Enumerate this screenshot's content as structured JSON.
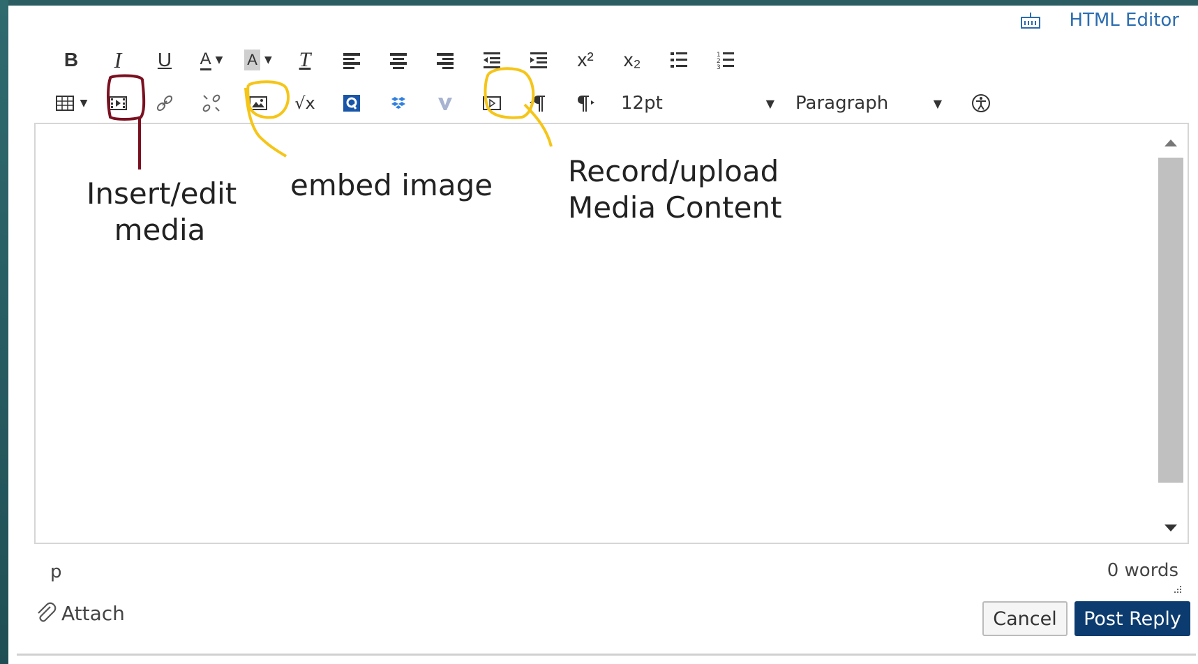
{
  "header": {
    "html_editor_label": "HTML Editor"
  },
  "toolbar": {
    "bold": "B",
    "italic": "I",
    "underline": "U",
    "text_color": "A",
    "bg_color": "A",
    "clear_format": "T",
    "superscript": "x²",
    "subscript": "x₂",
    "font_size": "12pt",
    "paragraph": "Paragraph",
    "math_label": "√x"
  },
  "annotations": {
    "insert_edit_media_line1": "Insert/edit",
    "insert_edit_media_line2": "media",
    "embed_image": "embed image",
    "record_upload_line1": "Record/upload",
    "record_upload_line2": "Media Content"
  },
  "status": {
    "path": "p",
    "word_count": "0 words"
  },
  "footer": {
    "attach_label": "Attach",
    "cancel_label": "Cancel",
    "post_label": "Post Reply"
  },
  "colors": {
    "accent_blue": "#2b6cb0",
    "post_button": "#0b3b6f",
    "annotation_maroon": "#7a1020",
    "annotation_yellow": "#f5c518"
  }
}
